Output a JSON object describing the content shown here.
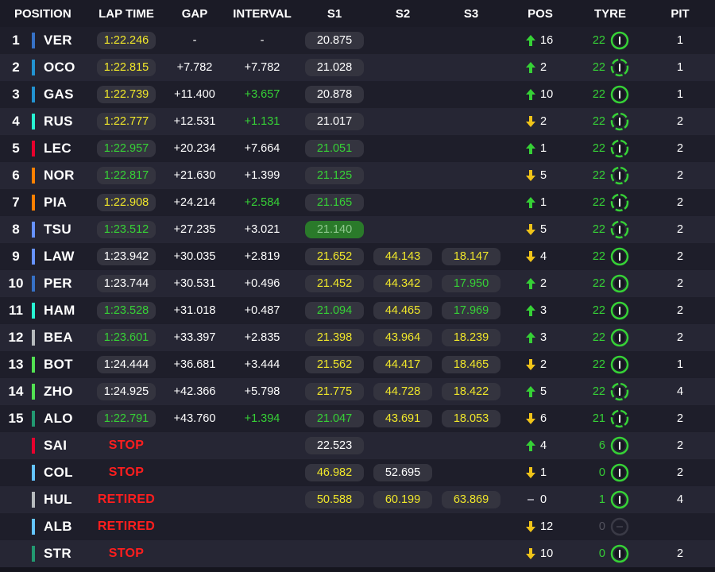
{
  "header": {
    "position": "POSITION",
    "lap_time": "LAP TIME",
    "gap": "GAP",
    "interval": "INTERVAL",
    "s1": "S1",
    "s2": "S2",
    "s3": "S3",
    "pos": "POS",
    "tyre": "TYRE",
    "pit": "PIT"
  },
  "colors": {
    "background": "#15151e",
    "row_odd": "#1e1e2a",
    "row_even": "#262634",
    "pill": "#34343f",
    "yellow": "#f0e72a",
    "green": "#36d136",
    "red": "#ff1e1e",
    "fastest_sector_bg": "#2a7a2a"
  },
  "rows": [
    {
      "pos": "1",
      "team_color": "#3671c6",
      "driver": "VER",
      "lap": "1:22.246",
      "lap_color": "yellow",
      "gap": "-",
      "interval": "-",
      "interval_color": "white",
      "s1": "20.875",
      "s1_color": "white",
      "s2": "",
      "s2_color": "white",
      "s3": "",
      "s3_color": "white",
      "dir": "up",
      "pos_change": "16",
      "tyre_age": "22",
      "tyre_icon": "medium-tyre-icon",
      "pit": "1"
    },
    {
      "pos": "2",
      "team_color": "#2293d1",
      "driver": "OCO",
      "lap": "1:22.815",
      "lap_color": "yellow",
      "gap": "+7.782",
      "interval": "+7.782",
      "interval_color": "white",
      "s1": "21.028",
      "s1_color": "white",
      "s2": "",
      "s2_color": "white",
      "s3": "",
      "s3_color": "white",
      "dir": "up",
      "pos_change": "2",
      "tyre_age": "22",
      "tyre_icon": "used-tyre-icon",
      "pit": "1"
    },
    {
      "pos": "3",
      "team_color": "#2293d1",
      "driver": "GAS",
      "lap": "1:22.739",
      "lap_color": "yellow",
      "gap": "+11.400",
      "interval": "+3.657",
      "interval_color": "green",
      "s1": "20.878",
      "s1_color": "white",
      "s2": "",
      "s2_color": "white",
      "s3": "",
      "s3_color": "white",
      "dir": "up",
      "pos_change": "10",
      "tyre_age": "22",
      "tyre_icon": "medium-tyre-icon",
      "pit": "1"
    },
    {
      "pos": "4",
      "team_color": "#27f4d2",
      "driver": "RUS",
      "lap": "1:22.777",
      "lap_color": "yellow",
      "gap": "+12.531",
      "interval": "+1.131",
      "interval_color": "green",
      "s1": "21.017",
      "s1_color": "white",
      "s2": "",
      "s2_color": "white",
      "s3": "",
      "s3_color": "white",
      "dir": "down",
      "pos_change": "2",
      "tyre_age": "22",
      "tyre_icon": "used-tyre-icon",
      "pit": "2"
    },
    {
      "pos": "5",
      "team_color": "#e8002d",
      "driver": "LEC",
      "lap": "1:22.957",
      "lap_color": "green",
      "gap": "+20.234",
      "interval": "+7.664",
      "interval_color": "white",
      "s1": "21.051",
      "s1_color": "green",
      "s2": "",
      "s2_color": "white",
      "s3": "",
      "s3_color": "white",
      "dir": "up",
      "pos_change": "1",
      "tyre_age": "22",
      "tyre_icon": "used-tyre-icon",
      "pit": "2"
    },
    {
      "pos": "6",
      "team_color": "#ff8000",
      "driver": "NOR",
      "lap": "1:22.817",
      "lap_color": "green",
      "gap": "+21.630",
      "interval": "+1.399",
      "interval_color": "white",
      "s1": "21.125",
      "s1_color": "green",
      "s2": "",
      "s2_color": "white",
      "s3": "",
      "s3_color": "white",
      "dir": "down",
      "pos_change": "5",
      "tyre_age": "22",
      "tyre_icon": "used-tyre-icon",
      "pit": "2"
    },
    {
      "pos": "7",
      "team_color": "#ff8000",
      "driver": "PIA",
      "lap": "1:22.908",
      "lap_color": "yellow",
      "gap": "+24.214",
      "interval": "+2.584",
      "interval_color": "green",
      "s1": "21.165",
      "s1_color": "green",
      "s2": "",
      "s2_color": "white",
      "s3": "",
      "s3_color": "white",
      "dir": "up",
      "pos_change": "1",
      "tyre_age": "22",
      "tyre_icon": "used-tyre-icon",
      "pit": "2"
    },
    {
      "pos": "8",
      "team_color": "#6692ff",
      "driver": "TSU",
      "lap": "1:23.512",
      "lap_color": "green",
      "gap": "+27.235",
      "interval": "+3.021",
      "interval_color": "white",
      "s1": "21.140",
      "s1_color": "fastest",
      "s2": "",
      "s2_color": "white",
      "s3": "",
      "s3_color": "white",
      "dir": "down",
      "pos_change": "5",
      "tyre_age": "22",
      "tyre_icon": "used-tyre-icon",
      "pit": "2"
    },
    {
      "pos": "9",
      "team_color": "#6692ff",
      "driver": "LAW",
      "lap": "1:23.942",
      "lap_color": "white",
      "gap": "+30.035",
      "interval": "+2.819",
      "interval_color": "white",
      "s1": "21.652",
      "s1_color": "yellow",
      "s2": "44.143",
      "s2_color": "yellow",
      "s3": "18.147",
      "s3_color": "yellow",
      "dir": "down",
      "pos_change": "4",
      "tyre_age": "22",
      "tyre_icon": "medium-tyre-icon",
      "pit": "2"
    },
    {
      "pos": "10",
      "team_color": "#3671c6",
      "driver": "PER",
      "lap": "1:23.744",
      "lap_color": "white",
      "gap": "+30.531",
      "interval": "+0.496",
      "interval_color": "white",
      "s1": "21.452",
      "s1_color": "yellow",
      "s2": "44.342",
      "s2_color": "yellow",
      "s3": "17.950",
      "s3_color": "green",
      "dir": "up",
      "pos_change": "2",
      "tyre_age": "22",
      "tyre_icon": "medium-tyre-icon",
      "pit": "2"
    },
    {
      "pos": "11",
      "team_color": "#27f4d2",
      "driver": "HAM",
      "lap": "1:23.528",
      "lap_color": "green",
      "gap": "+31.018",
      "interval": "+0.487",
      "interval_color": "white",
      "s1": "21.094",
      "s1_color": "green",
      "s2": "44.465",
      "s2_color": "yellow",
      "s3": "17.969",
      "s3_color": "green",
      "dir": "up",
      "pos_change": "3",
      "tyre_age": "22",
      "tyre_icon": "medium-tyre-icon",
      "pit": "2"
    },
    {
      "pos": "12",
      "team_color": "#b6babd",
      "driver": "BEA",
      "lap": "1:23.601",
      "lap_color": "green",
      "gap": "+33.397",
      "interval": "+2.835",
      "interval_color": "white",
      "s1": "21.398",
      "s1_color": "yellow",
      "s2": "43.964",
      "s2_color": "yellow",
      "s3": "18.239",
      "s3_color": "yellow",
      "dir": "up",
      "pos_change": "3",
      "tyre_age": "22",
      "tyre_icon": "medium-tyre-icon",
      "pit": "2"
    },
    {
      "pos": "13",
      "team_color": "#52e252",
      "driver": "BOT",
      "lap": "1:24.444",
      "lap_color": "white",
      "gap": "+36.681",
      "interval": "+3.444",
      "interval_color": "white",
      "s1": "21.562",
      "s1_color": "yellow",
      "s2": "44.417",
      "s2_color": "yellow",
      "s3": "18.465",
      "s3_color": "yellow",
      "dir": "down",
      "pos_change": "2",
      "tyre_age": "22",
      "tyre_icon": "medium-tyre-icon",
      "pit": "1"
    },
    {
      "pos": "14",
      "team_color": "#52e252",
      "driver": "ZHO",
      "lap": "1:24.925",
      "lap_color": "white",
      "gap": "+42.366",
      "interval": "+5.798",
      "interval_color": "white",
      "s1": "21.775",
      "s1_color": "yellow",
      "s2": "44.728",
      "s2_color": "yellow",
      "s3": "18.422",
      "s3_color": "yellow",
      "dir": "up",
      "pos_change": "5",
      "tyre_age": "22",
      "tyre_icon": "used-tyre-icon",
      "pit": "4"
    },
    {
      "pos": "15",
      "team_color": "#229971",
      "driver": "ALO",
      "lap": "1:22.791",
      "lap_color": "green",
      "gap": "+43.760",
      "interval": "+1.394",
      "interval_color": "green",
      "s1": "21.047",
      "s1_color": "green",
      "s2": "43.691",
      "s2_color": "yellow",
      "s3": "18.053",
      "s3_color": "yellow",
      "dir": "down",
      "pos_change": "6",
      "tyre_age": "21",
      "tyre_icon": "used-tyre-icon",
      "pit": "2"
    },
    {
      "pos": "",
      "team_color": "#e8002d",
      "driver": "SAI",
      "lap": "STOP",
      "lap_color": "red",
      "gap": "",
      "interval": "",
      "interval_color": "white",
      "s1": "22.523",
      "s1_color": "white",
      "s2": "",
      "s2_color": "white",
      "s3": "",
      "s3_color": "white",
      "dir": "up",
      "pos_change": "4",
      "tyre_age": "6",
      "tyre_icon": "medium-tyre-icon",
      "pit": "2"
    },
    {
      "pos": "",
      "team_color": "#64c4ff",
      "driver": "COL",
      "lap": "STOP",
      "lap_color": "red",
      "gap": "",
      "interval": "",
      "interval_color": "white",
      "s1": "46.982",
      "s1_color": "yellow",
      "s2": "52.695",
      "s2_color": "white",
      "s3": "",
      "s3_color": "white",
      "dir": "down",
      "pos_change": "1",
      "tyre_age": "0",
      "tyre_icon": "medium-tyre-icon",
      "pit": "2"
    },
    {
      "pos": "",
      "team_color": "#b6babd",
      "driver": "HUL",
      "lap": "RETIRED",
      "lap_color": "red",
      "gap": "",
      "interval": "",
      "interval_color": "white",
      "s1": "50.588",
      "s1_color": "yellow",
      "s2": "60.199",
      "s2_color": "yellow",
      "s3": "63.869",
      "s3_color": "yellow",
      "dir": "none",
      "pos_change": "0",
      "tyre_age": "1",
      "tyre_icon": "medium-tyre-icon",
      "pit": "4"
    },
    {
      "pos": "",
      "team_color": "#64c4ff",
      "driver": "ALB",
      "lap": "RETIRED",
      "lap_color": "red",
      "gap": "",
      "interval": "",
      "interval_color": "white",
      "s1": "",
      "s1_color": "white",
      "s2": "",
      "s2_color": "white",
      "s3": "",
      "s3_color": "white",
      "dir": "down",
      "pos_change": "12",
      "tyre_age": "0",
      "tyre_icon": "unknown-tyre-icon",
      "pit": ""
    },
    {
      "pos": "",
      "team_color": "#229971",
      "driver": "STR",
      "lap": "STOP",
      "lap_color": "red",
      "gap": "",
      "interval": "",
      "interval_color": "white",
      "s1": "",
      "s1_color": "white",
      "s2": "",
      "s2_color": "white",
      "s3": "",
      "s3_color": "white",
      "dir": "down",
      "pos_change": "10",
      "tyre_age": "0",
      "tyre_icon": "medium-tyre-icon",
      "pit": "2"
    }
  ]
}
